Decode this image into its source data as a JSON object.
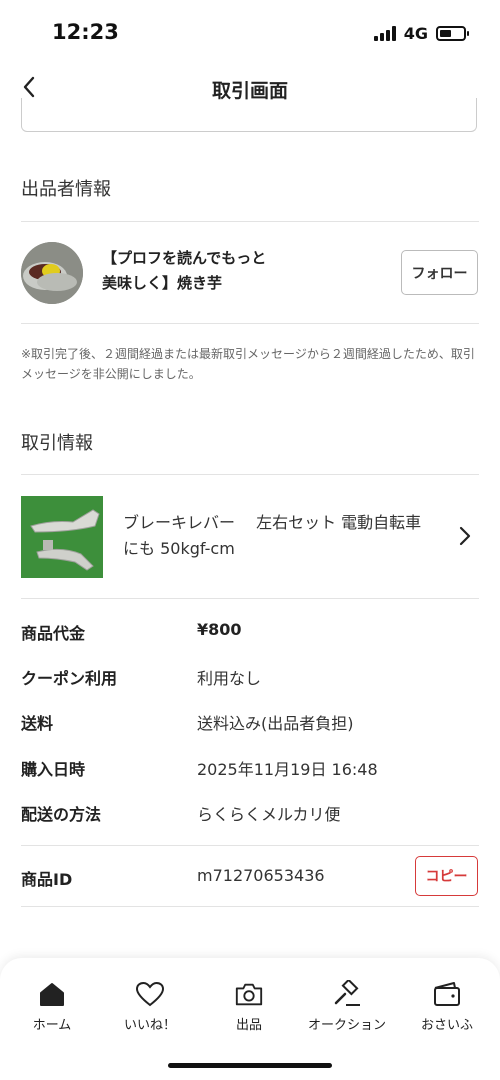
{
  "status_bar": {
    "time": "12:23",
    "network": "4G"
  },
  "header": {
    "title": "取引画面"
  },
  "seller_section": {
    "title": "出品者情報",
    "name_line1": "【プロフを読んでもっと",
    "name_line2": "美味しく】焼き芋",
    "follow_label": "フォロー",
    "notice": "※取引完了後、２週間経過または最新取引メッセージから２週間経過したため、取引メッセージを非公開にしました。"
  },
  "transaction_section": {
    "title": "取引情報",
    "product_name": "ブレーキレバー　 左右セット 電動自転車にも 50kgf-cm",
    "rows": [
      {
        "label": "商品代金",
        "value": "¥800"
      },
      {
        "label": "クーポン利用",
        "value": "利用なし"
      },
      {
        "label": "送料",
        "value": "送料込み(出品者負担)"
      },
      {
        "label": "購入日時",
        "value": "2025年11月19日 16:48"
      },
      {
        "label": "配送の方法",
        "value": "らくらくメルカリ便"
      }
    ],
    "item_id_label": "商品ID",
    "item_id_value": "m71270653436",
    "copy_label": "コピー"
  },
  "tab_bar": {
    "tabs": [
      {
        "label": "ホーム",
        "icon": "home-icon"
      },
      {
        "label": "いいね！",
        "icon": "heart-icon"
      },
      {
        "label": "出品",
        "icon": "camera-icon"
      },
      {
        "label": "オークション",
        "icon": "gavel-icon"
      },
      {
        "label": "おさいふ",
        "icon": "wallet-icon"
      }
    ]
  },
  "colors": {
    "accent": "#d63a3a",
    "divider": "#e3e3e3"
  }
}
